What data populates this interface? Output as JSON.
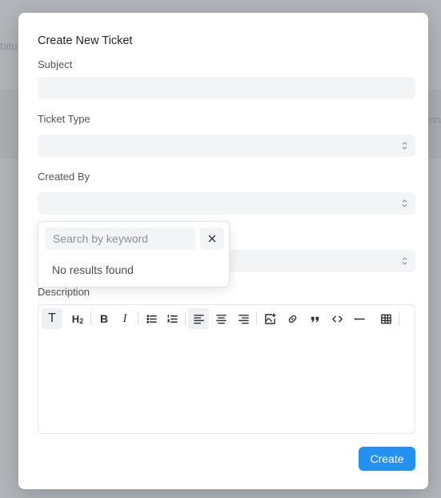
{
  "background": {
    "frag_left_top": "tatu",
    "frag_right_mid": "on-"
  },
  "modal": {
    "title": "Create New Ticket",
    "fields": {
      "subject_label": "Subject",
      "ticket_type_label": "Ticket Type",
      "created_by_label": "Created By",
      "description_label": "Description"
    },
    "dropdown": {
      "search_placeholder": "Search by keyword",
      "empty_text": "No results found"
    },
    "toolbar": {
      "heading_text": "T",
      "h2_text": "H",
      "h2_sub": "2",
      "bold_text": "B",
      "italic_text": "I"
    },
    "create_label": "Create"
  },
  "colors": {
    "accent": "#2490ef",
    "overlay": "#b1b4b9",
    "field_bg": "#f3f4f6"
  }
}
